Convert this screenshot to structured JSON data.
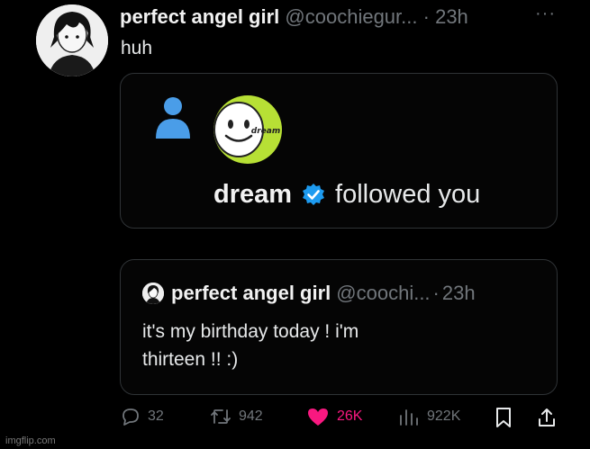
{
  "tweet": {
    "author_name": "perfect angel girl",
    "author_handle": "@coochiegur...",
    "separator": "·",
    "time": "23h",
    "more_label": "···",
    "text": "huh"
  },
  "follow_card": {
    "logo_text": "dream",
    "username": "dream",
    "action_text": "followed you"
  },
  "quote": {
    "author_name": "perfect angel girl",
    "author_handle": "@coochi...",
    "separator": "·",
    "time": "23h",
    "text_line1": "it's my birthday today ! i'm",
    "text_line2": "thirteen !! :)"
  },
  "actions": {
    "replies": "32",
    "retweets": "942",
    "likes": "26K",
    "views": "922K"
  },
  "watermark": "imgflip.com",
  "colors": {
    "background": "#000000",
    "muted": "#71767b",
    "like": "#f91880",
    "verified": "#1d9bf0",
    "dream_green": "#b7e035"
  }
}
